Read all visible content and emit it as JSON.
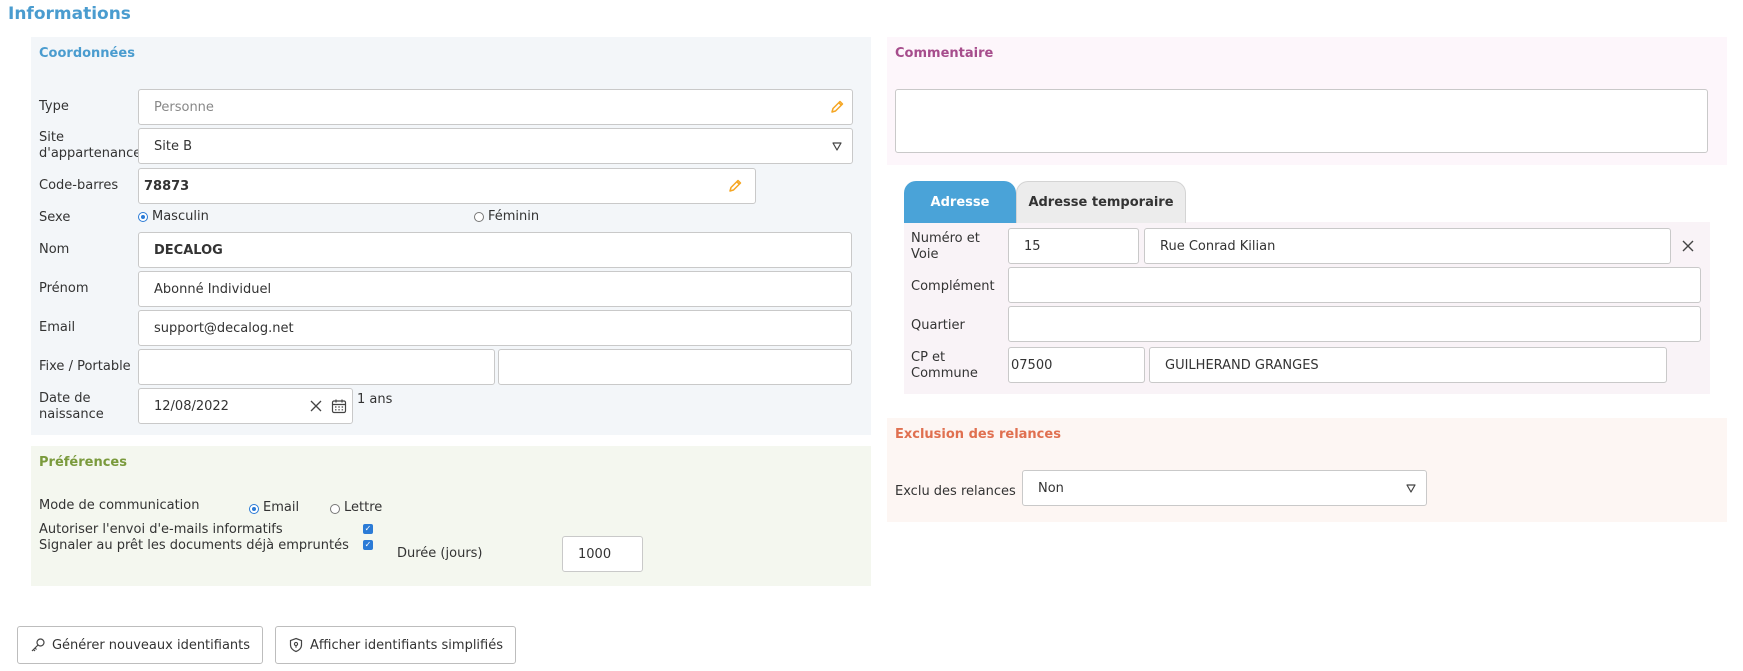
{
  "page_title": "Informations",
  "coordonnees": {
    "title": "Coordonnées",
    "type": {
      "label": "Type",
      "placeholder": "Personne"
    },
    "site": {
      "label_line1": "Site",
      "label_line2": "d'appartenance",
      "value": "Site B"
    },
    "code_barres": {
      "label": "Code-barres",
      "value": "78873"
    },
    "sexe": {
      "label": "Sexe",
      "option1": "Masculin",
      "option2": "Féminin",
      "selected": "Masculin"
    },
    "nom": {
      "label": "Nom",
      "value": "DECALOG"
    },
    "prenom": {
      "label": "Prénom",
      "value": "Abonné Individuel"
    },
    "email": {
      "label": "Email",
      "value": "support@decalog.net"
    },
    "fixe_portable": {
      "label": "Fixe / Portable",
      "fixe": "",
      "portable": ""
    },
    "naissance": {
      "label_line1": "Date de",
      "label_line2": "naissance",
      "value": "12/08/2022",
      "age": "1 ans"
    }
  },
  "preferences": {
    "title": "Préférences",
    "mode": {
      "label": "Mode de communication",
      "option1": "Email",
      "option2": "Lettre",
      "selected": "Email"
    },
    "autoriser": {
      "label": "Autoriser l'envoi d'e-mails informatifs",
      "checked": true
    },
    "signaler": {
      "label": "Signaler au prêt les documents déjà empruntés",
      "checked": true
    },
    "duree": {
      "label": "Durée (jours)",
      "value": "1000"
    }
  },
  "commentaire": {
    "title": "Commentaire",
    "value": ""
  },
  "adresse": {
    "tabs": [
      {
        "label": "Adresse",
        "active": true
      },
      {
        "label": "Adresse temporaire",
        "active": false
      }
    ],
    "numero_voie": {
      "label_line1": "Numéro et",
      "label_line2": "Voie",
      "numero": "15",
      "voie": "Rue Conrad Kilian"
    },
    "complement": {
      "label": "Complément",
      "value": ""
    },
    "quartier": {
      "label": "Quartier",
      "value": ""
    },
    "cp_commune": {
      "label_line1": "CP et",
      "label_line2": "Commune",
      "cp": "07500",
      "commune": "GUILHERAND GRANGES"
    }
  },
  "exclusion": {
    "title": "Exclusion des relances",
    "label": "Exclu des relances",
    "value": "Non"
  },
  "buttons": {
    "generer": "Générer nouveaux identifiants",
    "afficher": "Afficher identifiants simplifiés"
  },
  "colors": {
    "title_blue": "#4a9ccf",
    "coord_title": "#4a9ccf",
    "pref_title": "#7a9a3c",
    "comment_title": "#a64d8c",
    "exclusion_title": "#e07050",
    "tab_active": "#4aa3d8",
    "pencil": "#f5a623"
  },
  "icons": {
    "pencil": "pencil-icon",
    "dropdown": "chevron-down-icon",
    "clear": "close-icon",
    "calendar": "calendar-icon",
    "key": "key-icon",
    "shield": "shield-icon"
  }
}
